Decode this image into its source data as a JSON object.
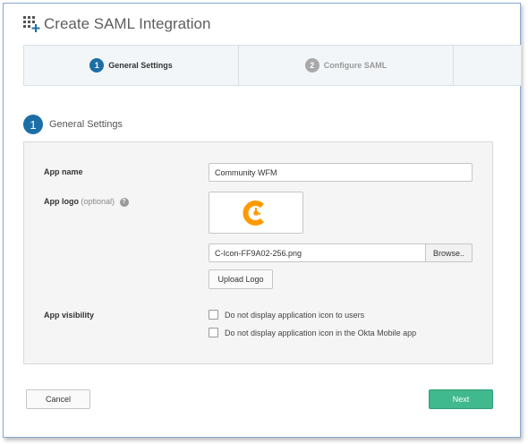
{
  "header": {
    "title": "Create SAML Integration",
    "icon": "add-app-grid-icon"
  },
  "stepper": {
    "steps": [
      {
        "number": "1",
        "label": "General Settings",
        "state": "active"
      },
      {
        "number": "2",
        "label": "Configure SAML",
        "state": "inactive"
      },
      {
        "number": "",
        "label": "",
        "state": "inactive"
      }
    ]
  },
  "section": {
    "number": "1",
    "title": "General Settings"
  },
  "form": {
    "app_name": {
      "label": "App name",
      "value": "Community WFM"
    },
    "app_logo": {
      "label": "App logo",
      "optional": "(optional)",
      "help": "?",
      "file_name": "C-Icon-FF9A02-256.png",
      "browse_label": "Browse..",
      "upload_label": "Upload Logo",
      "logo_color": "#ff9a02"
    },
    "app_visibility": {
      "label": "App visibility",
      "options": [
        {
          "label": "Do not display application icon to users",
          "checked": false
        },
        {
          "label": "Do not display application icon in the Okta Mobile app",
          "checked": false
        }
      ]
    }
  },
  "footer": {
    "cancel_label": "Cancel",
    "next_label": "Next"
  },
  "colors": {
    "primary": "#1c6fa6",
    "next": "#3fb98d"
  }
}
